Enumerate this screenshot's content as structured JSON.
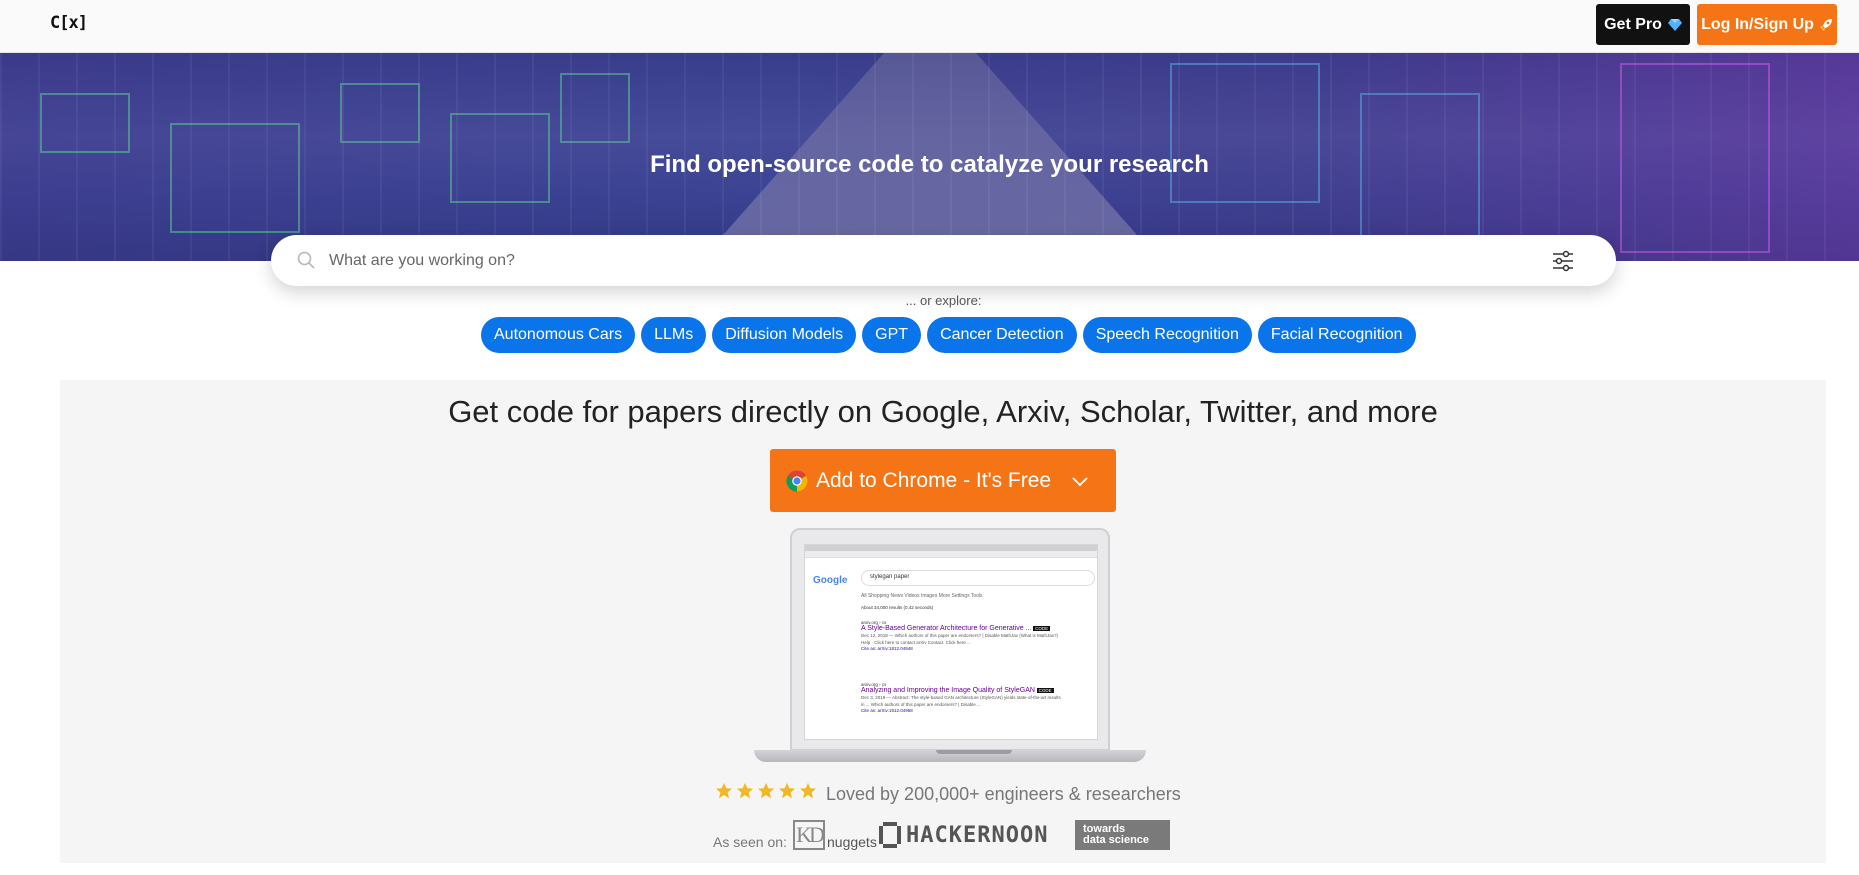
{
  "nav": {
    "logo": "C[x]",
    "get_pro_label": "Get Pro",
    "login_label": "Log In/Sign Up"
  },
  "hero": {
    "title": "Find open-source code to catalyze your research"
  },
  "search": {
    "placeholder": "What are you working on?"
  },
  "explore": {
    "label": "... or explore:",
    "chips": [
      "Autonomous Cars",
      "LLMs",
      "Diffusion Models",
      "GPT",
      "Cancer Detection",
      "Speech Recognition",
      "Facial Recognition"
    ]
  },
  "promo": {
    "title": "Get code for papers directly on Google, Arxiv, Scholar, Twitter, and more",
    "chrome_button_label": "Add to Chrome - It's Free",
    "laptop": {
      "google_logo": "Google",
      "query": "stylegan paper",
      "tabs": "All   Shopping   News   Videos   Images   More      Settings   Tools",
      "stats": "About 34,000 results (0.42 seconds)",
      "results": [
        {
          "cite": "arxiv.org › cs",
          "title": "A Style-Based Generator Architecture for Generative ...",
          "code_tag": "CODE",
          "snippet": "Dec 12, 2018 — Which authors of this paper are endorsers? | Disable MathJax (What is MathJax?) Help · Click here to contact arXiv Contact. Click here ...",
          "meta": "Cite as: arXiv:1812.04948"
        },
        {
          "cite": "arxiv.org › cs",
          "title": "Analyzing and Improving the Image Quality of StyleGAN",
          "code_tag": "CODE",
          "snippet": "Dec 3, 2019 — Abstract: The style-based GAN architecture (StyleGAN) yields state-of-the-art results in ... Which authors of this paper are endorsers? | Disable ...",
          "meta": "Cite as: arXiv:1912.04958"
        }
      ]
    },
    "rating_stars": 5,
    "loved_text": "Loved by 200,000+ engineers & researchers",
    "seen_on_label": "As seen on:",
    "press": {
      "kd_mark": "KD",
      "kd_text": "nuggets",
      "hackernoon": "HACKERNOON",
      "tds_line1": "towards",
      "tds_line2": "data science"
    }
  },
  "colors": {
    "accent_orange": "#f57415",
    "chip_blue": "#0a74ea",
    "star_gold": "#f2b824"
  }
}
